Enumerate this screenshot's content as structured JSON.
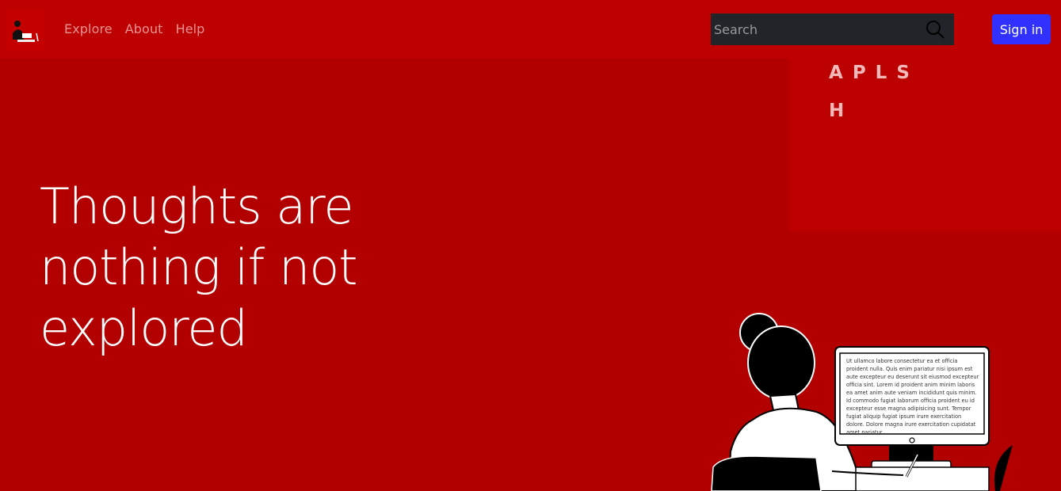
{
  "nav": {
    "links": [
      "Explore",
      "About",
      "Help"
    ],
    "search_placeholder": "Search",
    "signin_label": "Sign in"
  },
  "side_panel": {
    "tag_rows": [
      [
        "A",
        "P",
        "L",
        "S"
      ],
      [
        "H"
      ]
    ]
  },
  "hero": {
    "title": "Thoughts are nothing if not explored"
  },
  "illustration": {
    "screen_text": "Ut ullamco labore consectetur ea et officia proident nulla. Quis enim pariatur nisi ipsum est aute excepteur eu deserunt sit eiusmod excepteur officia sint. Lorem id proident anim minim laboris ea amet anim aute veniam incididunt quis minim. Id commodo fugiat laborum officia proident eu id excepteur esse magna adipisicing sunt. Tempor fugiat aliquip fugiat ipsum irure exercitation dolore. Dolore magna irure exercitation cupidatat amet pariatur"
  },
  "colors": {
    "background": "#b20000",
    "navbar": "#bd0000",
    "signin_button": "#3030ff",
    "search_bg": "#212529"
  }
}
